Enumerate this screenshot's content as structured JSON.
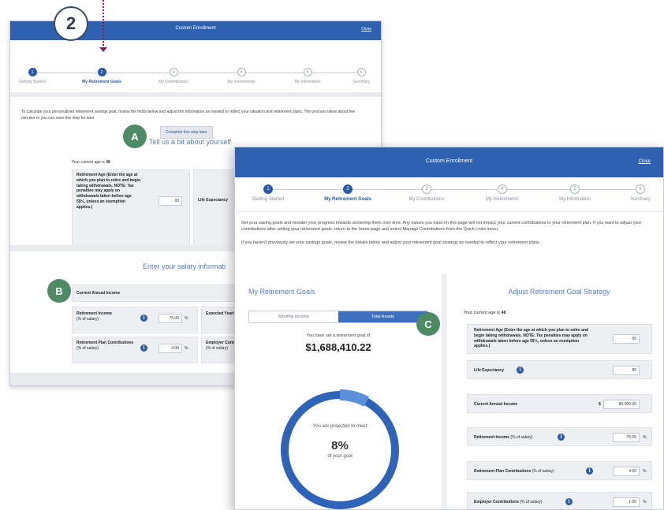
{
  "callouts": {
    "step": "2",
    "a": "A",
    "b": "B",
    "c": "C"
  },
  "back": {
    "title": "Custom Enrollment",
    "close": "Close",
    "steps": [
      {
        "num": "1",
        "label": "Getting Started"
      },
      {
        "num": "2",
        "label": "My Retirement Goals"
      },
      {
        "num": "3",
        "label": "My Contributions"
      },
      {
        "num": "4",
        "label": "My Investments"
      },
      {
        "num": "5",
        "label": "My Information"
      },
      {
        "num": "6",
        "label": "Summary"
      }
    ],
    "intro": "To calculate your personalized retirement savings goal, review the fields below and adjust the information as needed to reflect your situation and retirement plans. This process takes about five minutes or you can save this step for later.",
    "complete_later": "Complete this step later",
    "tell_us": "Tell us a bit about yourself",
    "age_label": "Your current age is",
    "age_value": "48",
    "retirement_age_label": "Retirement Age (Enter the age at which you plan to retire and begin taking withdrawals. NOTE: Tax penalties may apply on withdrawals taken before age 59½, unless an exemption applies.)",
    "retirement_age_value": "60",
    "life_expectancy_label": "Life Expectancy",
    "salary_title": "Enter your salary informati",
    "current_income_label": "Current Annual Income",
    "retirement_income_label": "Retirement Income",
    "retirement_income_sub": "(% of salary)",
    "retirement_income_value": "75.00",
    "expected_yearly_label": "Expected Yearly Increase",
    "plan_contrib_label": "Retirement Plan Contributions",
    "plan_contrib_sub": "(% of salary)",
    "plan_contrib_value": "4.00",
    "employer_contrib_label": "Employer Contri",
    "employer_contrib_sub": "(% of salary)",
    "percent": "%"
  },
  "front": {
    "title": "Custom Enrollment",
    "close": "Close",
    "steps": [
      {
        "num": "1",
        "label": "Getting Started"
      },
      {
        "num": "2",
        "label": "My Retirement Goals"
      },
      {
        "num": "3",
        "label": "My Contributions"
      },
      {
        "num": "4",
        "label": "My Investments"
      },
      {
        "num": "5",
        "label": "My Information"
      },
      {
        "num": "6",
        "label": "Summary"
      }
    ],
    "intro1": "Set your saving goals and monitor your progress towards achieving them over time. Any values you input on this page will not impact your current contributions to your retirement plan. If you want to adjust your contributions after setting your retirement goals, return to the home page and select Manage Contributions from the Quick Links menu.",
    "intro2": "If you haven't previously set your savings goals, review the details below and adjust your retirement goal strategy as needed to reflect your retirement plans.",
    "goals_title": "My Retirement Goals",
    "toggle_monthly": "Monthly income",
    "toggle_total": "Total Assets",
    "goal_text": "You have set a retirement goal of",
    "goal_value": "$1,688,410.22",
    "projected_text": "You are projected to meet",
    "projected_pct": "8%",
    "of_goal": "of your goal",
    "progress_fraction": 0.08,
    "colors": {
      "ring": "#2f63b8",
      "accent": "#5b8fd8",
      "brand": "#2e62b1"
    },
    "adjust_title": "Adjust Retirement Goal Strategy",
    "age_label": "Your current age is",
    "age_value": "48",
    "rows": [
      {
        "label": "Retirement Age (Enter the age at which you plan to retire and begin taking withdrawals. NOTE: Tax penalties may apply on withdrawals taken before age 59½, unless an exemption applies.)",
        "sub": "",
        "value": "65",
        "info": false,
        "unit": "",
        "prefix": ""
      },
      {
        "label": "Life Expectancy",
        "sub": "",
        "value": "85",
        "info": true,
        "unit": "",
        "prefix": ""
      },
      {
        "label": "Current Annual Income",
        "sub": "",
        "value": "80,000.00",
        "info": false,
        "unit": "",
        "prefix": "$"
      },
      {
        "label": "Retirement Income",
        "sub": "(% of salary)",
        "value": "75.00",
        "info": true,
        "unit": "%",
        "prefix": ""
      },
      {
        "label": "Retirement Plan Contributions",
        "sub": "(% of salary)",
        "value": "4.00",
        "info": true,
        "unit": "%",
        "prefix": ""
      },
      {
        "label": "Employer Contributions",
        "sub": "(% of salary)",
        "value": "1.00",
        "info": true,
        "unit": "%",
        "prefix": ""
      }
    ],
    "info_glyph": "i"
  }
}
